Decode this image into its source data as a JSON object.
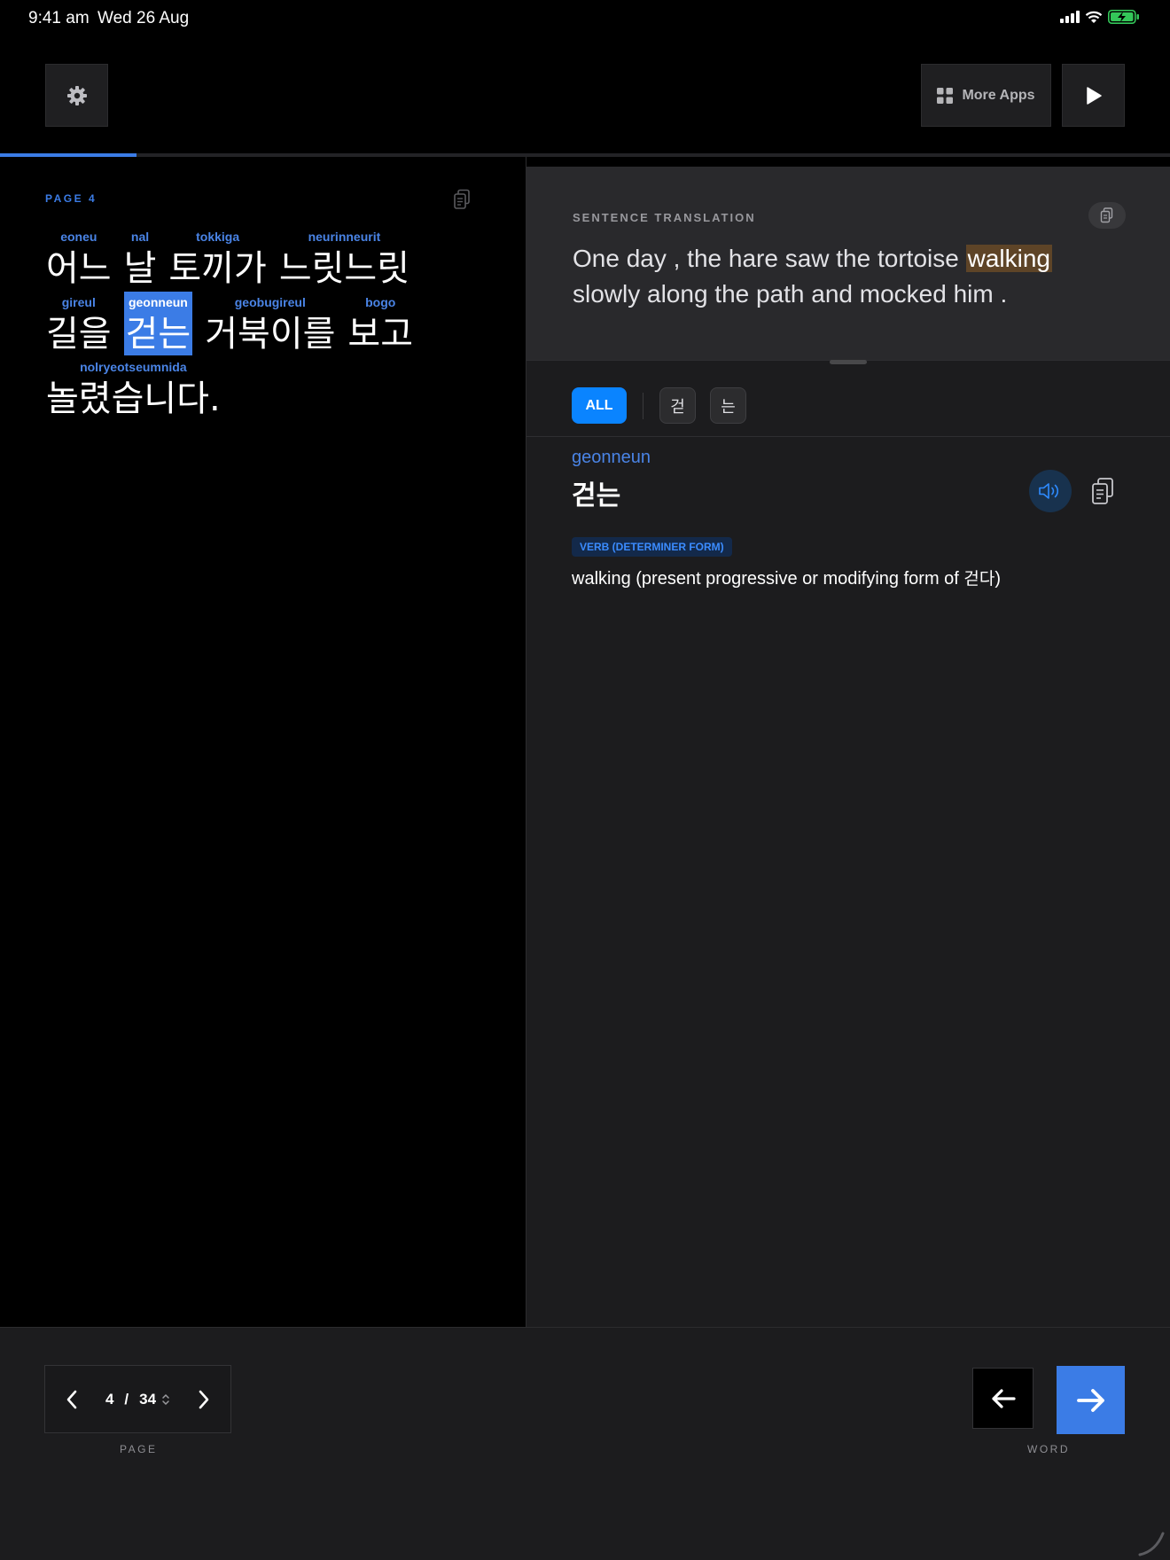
{
  "status_bar": {
    "time": "9:41 am",
    "date": "Wed 26 Aug"
  },
  "toolbar": {
    "more_apps_label": "More Apps"
  },
  "reading_progress": 0.117,
  "passage": {
    "page_label": "PAGE  4",
    "lines": [
      [
        {
          "romaja": "eoneu",
          "hangul": "어느"
        },
        {
          "romaja": "nal",
          "hangul": "날"
        },
        {
          "romaja": "tokkiga",
          "hangul": "토끼가"
        },
        {
          "romaja": "neurinneurit",
          "hangul": "느릿느릿"
        }
      ],
      [
        {
          "romaja": "gireul",
          "hangul": "길을"
        },
        {
          "romaja": "geonneun",
          "hangul": "걷는",
          "active": true
        },
        {
          "romaja": "geobugireul",
          "hangul": "거북이를"
        },
        {
          "romaja": "bogo",
          "hangul": "보고"
        }
      ],
      [
        {
          "romaja": "nolryeotseumnida",
          "hangul": "놀렸습니다."
        }
      ]
    ]
  },
  "translation": {
    "section_label": "SENTENCE TRANSLATION",
    "before": "One day , the hare saw the tortoise ",
    "highlight": "walking",
    "after": " slowly along the path and mocked him ."
  },
  "word_tabs": {
    "all_label": "ALL",
    "morphemes": [
      "걷",
      "는"
    ]
  },
  "word_detail": {
    "romaja": "geonneun",
    "hangul": "걷는",
    "pos": "VERB (DETERMINER FORM)",
    "definition_prefix": "walking (present progressive or modifying form of ",
    "definition_ko": "걷다",
    "definition_suffix": ")"
  },
  "pager": {
    "current": "4",
    "total": "34",
    "caption": "PAGE"
  },
  "word_nav": {
    "caption": "WORD"
  },
  "colors": {
    "accent": "#3b7ce6",
    "tab_active": "#0a84ff",
    "highlight": "#5e4427"
  }
}
